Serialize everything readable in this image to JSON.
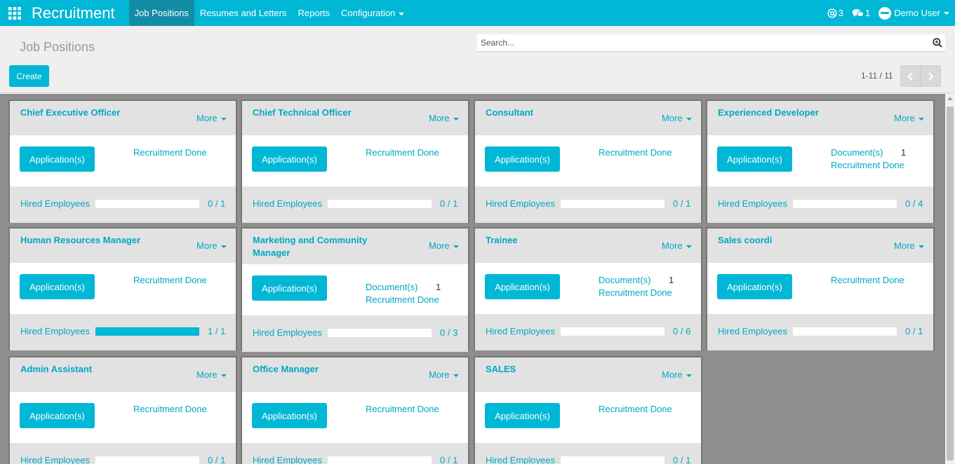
{
  "app": {
    "title": "Recruitment",
    "menu": [
      {
        "label": "Job Positions",
        "active": true
      },
      {
        "label": "Resumes and Letters",
        "active": false
      },
      {
        "label": "Reports",
        "active": false
      },
      {
        "label": "Configuration",
        "active": false
      }
    ],
    "mentions_count": "3",
    "messages_count": "1",
    "user": "Demo User",
    "accent_color": "#00b7d6"
  },
  "control_panel": {
    "breadcrumb": "Job Positions",
    "search_placeholder": "Search...",
    "create_label": "Create",
    "pager": "1-11 / 11"
  },
  "jobs": [
    {
      "title": "Chief Executive Officer",
      "more": "More",
      "button": "Application(s)",
      "documents_label": "",
      "documents_count": "",
      "recruitment_label": "Recruitment Done",
      "hired_label": "Hired Employees",
      "hired": 0,
      "target": 1,
      "hired_text": "0 / 1"
    },
    {
      "title": "Chief Technical Officer",
      "more": "More",
      "button": "Application(s)",
      "documents_label": "",
      "documents_count": "",
      "recruitment_label": "Recruitment Done",
      "hired_label": "Hired Employees",
      "hired": 0,
      "target": 1,
      "hired_text": "0 / 1"
    },
    {
      "title": "Consultant",
      "more": "More",
      "button": "Application(s)",
      "documents_label": "",
      "documents_count": "",
      "recruitment_label": "Recruitment Done",
      "hired_label": "Hired Employees",
      "hired": 0,
      "target": 1,
      "hired_text": "0 / 1"
    },
    {
      "title": "Experienced Developer",
      "more": "More",
      "button": "Application(s)",
      "documents_label": "Document(s)",
      "documents_count": "1",
      "recruitment_label": "Recruitment Done",
      "hired_label": "Hired Employees",
      "hired": 0,
      "target": 4,
      "hired_text": "0 / 4"
    },
    {
      "title": "Human Resources Manager",
      "more": "More",
      "button": "Application(s)",
      "documents_label": "",
      "documents_count": "",
      "recruitment_label": "Recruitment Done",
      "hired_label": "Hired Employees",
      "hired": 1,
      "target": 1,
      "hired_text": "1 / 1"
    },
    {
      "title": "Marketing and Community Manager",
      "more": "More",
      "button": "Application(s)",
      "documents_label": "Document(s)",
      "documents_count": "1",
      "recruitment_label": "Recruitment Done",
      "hired_label": "Hired Employees",
      "hired": 0,
      "target": 3,
      "hired_text": "0 / 3"
    },
    {
      "title": "Trainee",
      "more": "More",
      "button": "Application(s)",
      "documents_label": "Document(s)",
      "documents_count": "1",
      "recruitment_label": "Recruitment Done",
      "hired_label": "Hired Employees",
      "hired": 0,
      "target": 6,
      "hired_text": "0 / 6"
    },
    {
      "title": "Sales coordi",
      "more": "More",
      "button": "Application(s)",
      "documents_label": "",
      "documents_count": "",
      "recruitment_label": "Recruitment Done",
      "hired_label": "Hired Employees",
      "hired": 0,
      "target": 1,
      "hired_text": "0 / 1"
    },
    {
      "title": "Admin Assistant",
      "more": "More",
      "button": "Application(s)",
      "documents_label": "",
      "documents_count": "",
      "recruitment_label": "Recruitment Done",
      "hired_label": "Hired Employees",
      "hired": 0,
      "target": 1,
      "hired_text": "0 / 1"
    },
    {
      "title": "Office Manager",
      "more": "More",
      "button": "Application(s)",
      "documents_label": "",
      "documents_count": "",
      "recruitment_label": "Recruitment Done",
      "hired_label": "Hired Employees",
      "hired": 0,
      "target": 1,
      "hired_text": "0 / 1"
    },
    {
      "title": "SALES",
      "more": "More",
      "button": "Application(s)",
      "documents_label": "",
      "documents_count": "",
      "recruitment_label": "Recruitment Done",
      "hired_label": "Hired Employees",
      "hired": 0,
      "target": 1,
      "hired_text": "0 / 1"
    }
  ]
}
